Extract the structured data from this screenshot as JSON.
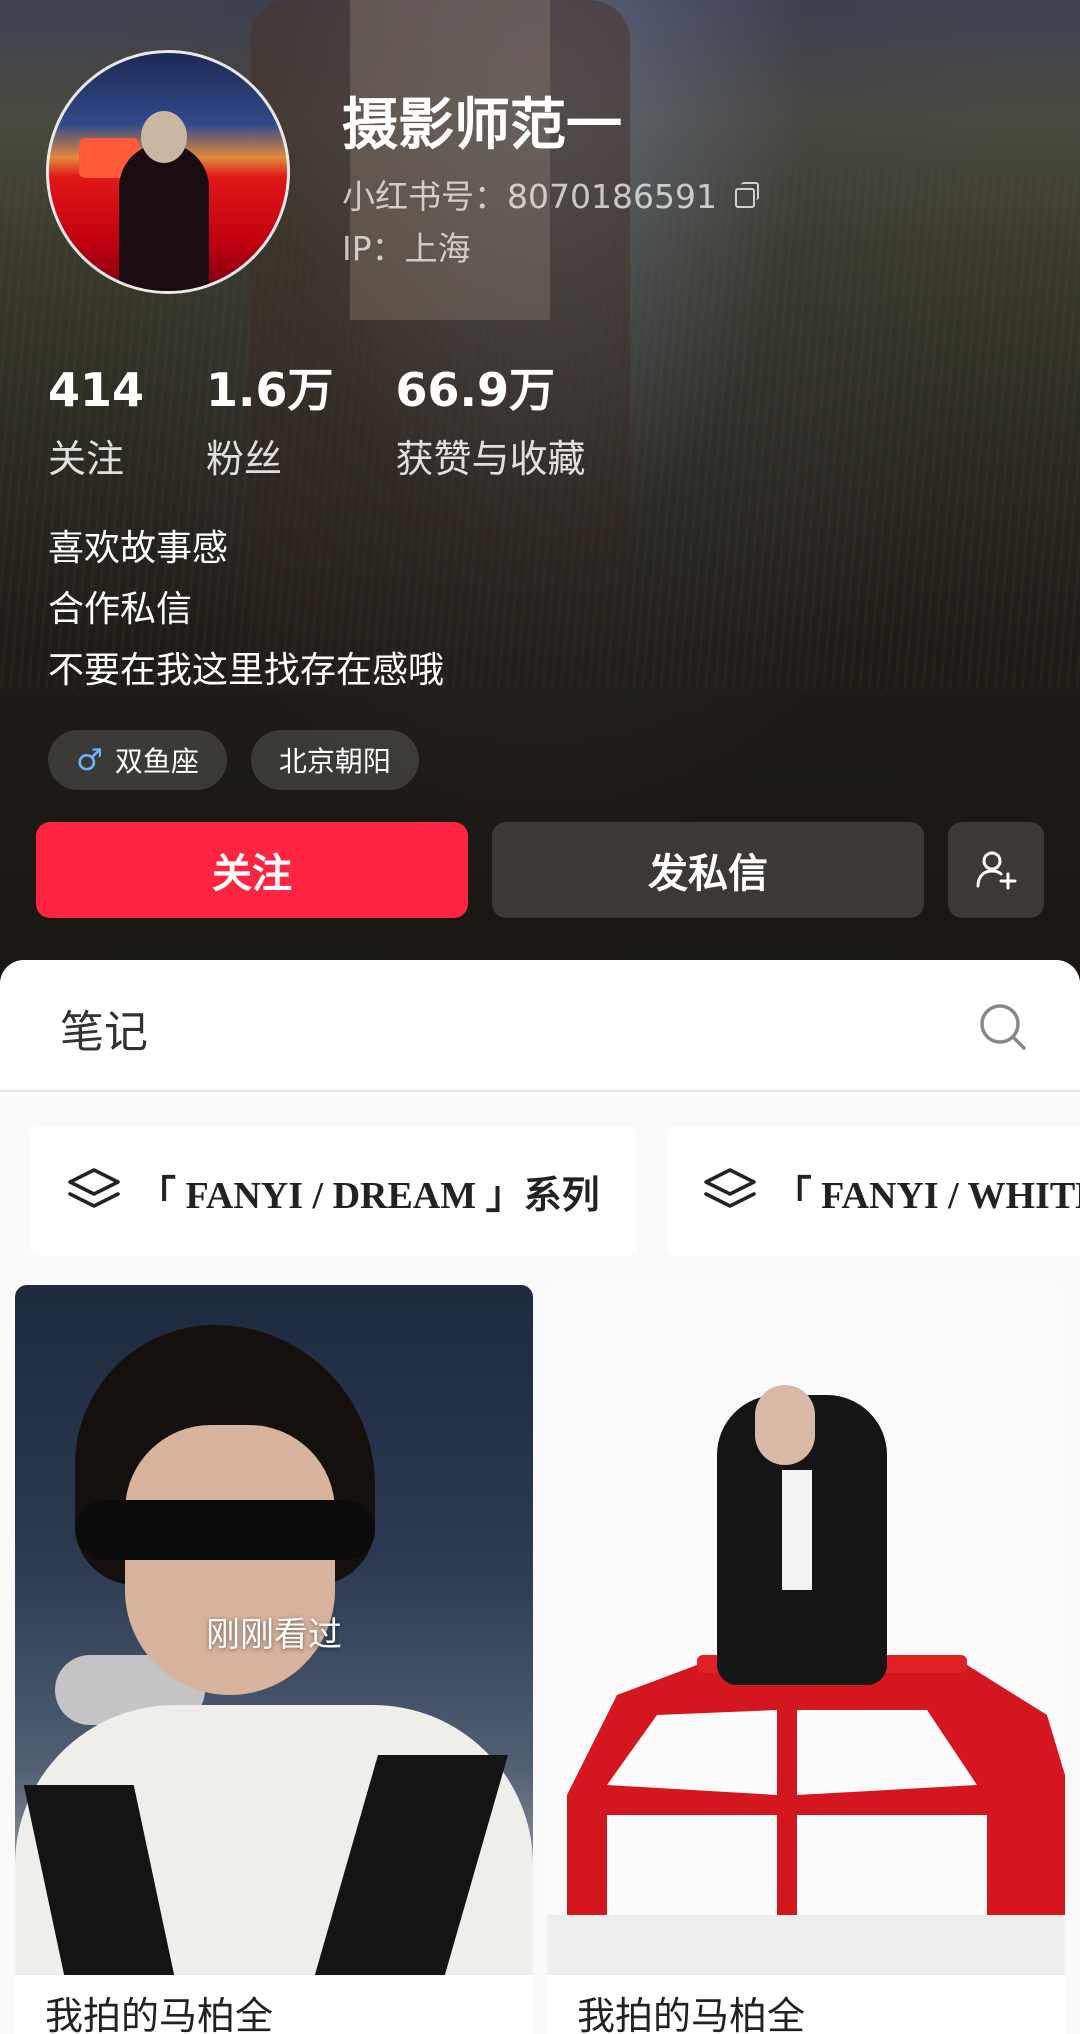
{
  "profile": {
    "name": "摄影师范一",
    "redbook_id": "小红书号：8070186591",
    "ip": "IP：上海"
  },
  "stats": [
    {
      "value": "414",
      "label": "关注"
    },
    {
      "value": "1.6万",
      "label": "粉丝"
    },
    {
      "value": "66.9万",
      "label": "获赞与收藏"
    }
  ],
  "bio": [
    "喜欢故事感",
    "合作私信",
    "不要在我这里找存在感哦"
  ],
  "tags": [
    {
      "icon": "male-icon",
      "label": "双鱼座"
    },
    {
      "label": "北京朝阳"
    }
  ],
  "actions": {
    "follow": "关注",
    "message": "发私信",
    "add_friend_icon": "add-user-icon"
  },
  "tabs": {
    "notes": "笔记",
    "search_icon": "search-icon"
  },
  "collections": [
    "「 FANYI / DREAM 」系列",
    "「 FANYI / WHITE"
  ],
  "notes": [
    {
      "badge": "刚刚看过",
      "title": "我拍的马柏全"
    },
    {
      "title": "我拍的马柏全"
    }
  ],
  "colors": {
    "accent": "#ff2442",
    "hero_dark": "#1a1713"
  }
}
